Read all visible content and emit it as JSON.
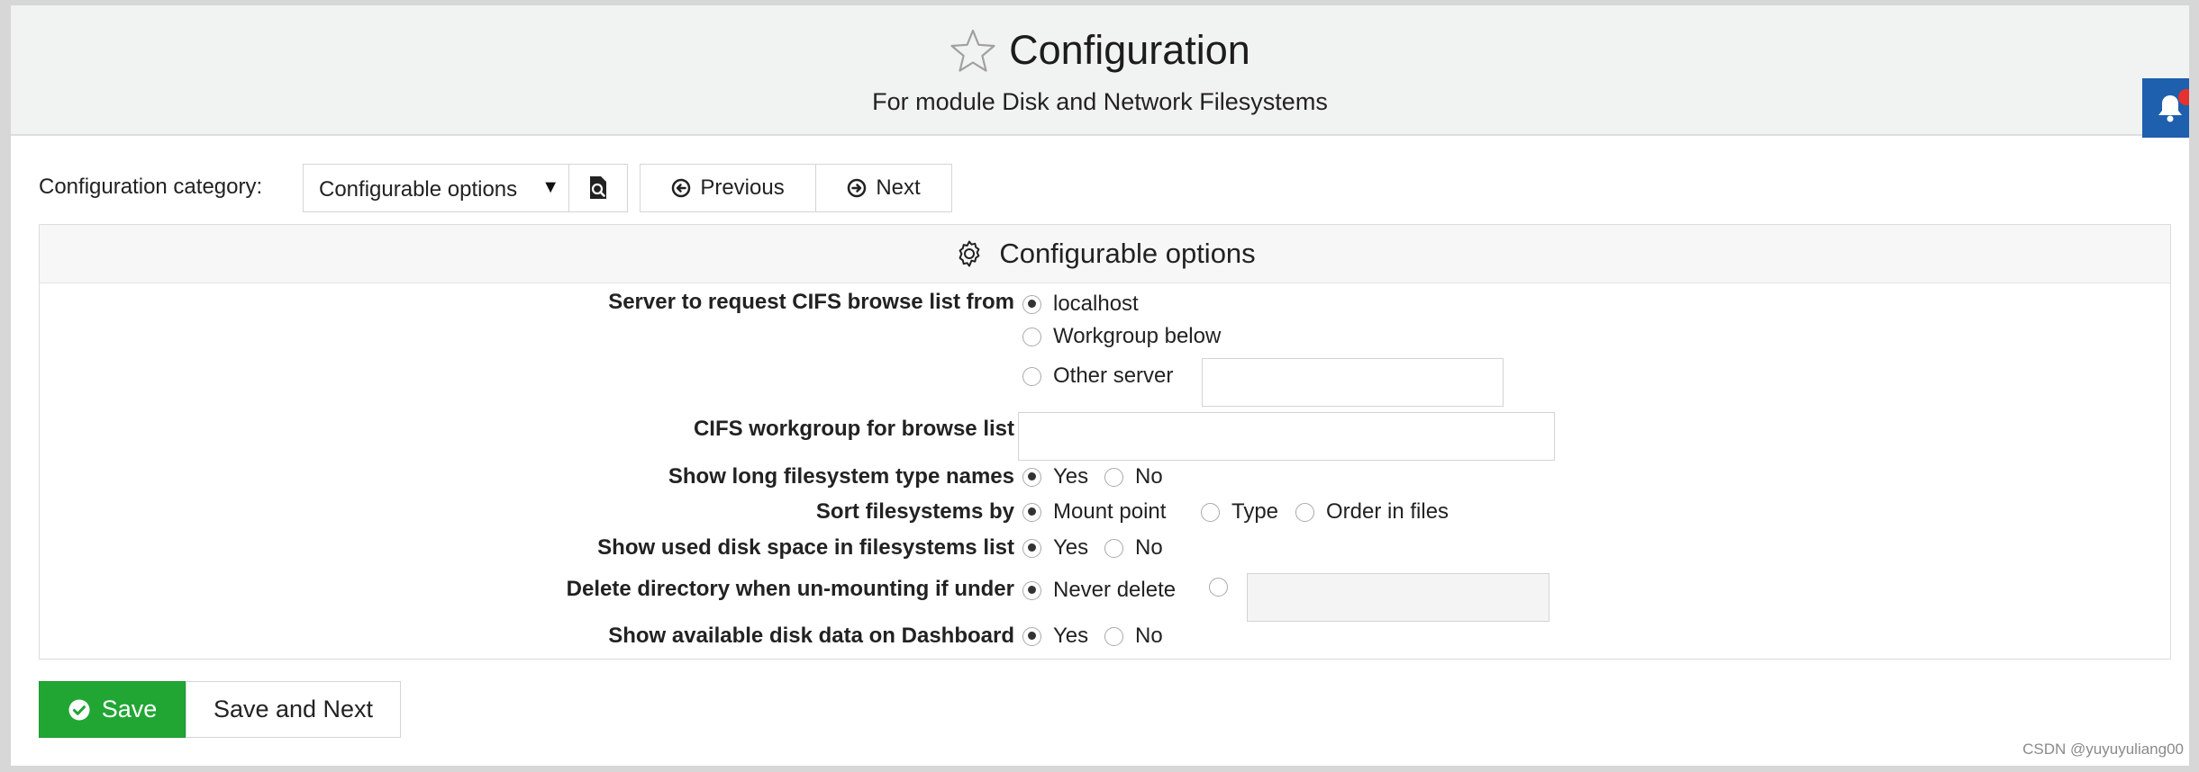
{
  "header": {
    "title": "Configuration",
    "subtitle": "For module Disk and Network Filesystems"
  },
  "toolbar": {
    "category_label": "Configuration category:",
    "category_value": "Configurable options",
    "previous_label": "Previous",
    "next_label": "Next"
  },
  "panel": {
    "title": "Configurable options",
    "rows": [
      {
        "label": "Server to request CIFS browse list from",
        "options": [
          {
            "label": "localhost",
            "selected": true
          },
          {
            "label": "Workgroup below",
            "selected": false
          },
          {
            "label": "Other server",
            "selected": false
          }
        ],
        "input_value": ""
      },
      {
        "label": "CIFS workgroup for browse list",
        "input_value": ""
      },
      {
        "label": "Show long filesystem type names",
        "options": [
          {
            "label": "Yes",
            "selected": true
          },
          {
            "label": "No",
            "selected": false
          }
        ]
      },
      {
        "label": "Sort filesystems by",
        "options": [
          {
            "label": "Mount point",
            "selected": true
          },
          {
            "label": "Type",
            "selected": false
          },
          {
            "label": "Order in files",
            "selected": false
          }
        ]
      },
      {
        "label": "Show used disk space in filesystems list",
        "options": [
          {
            "label": "Yes",
            "selected": true
          },
          {
            "label": "No",
            "selected": false
          }
        ]
      },
      {
        "label": "Delete directory when un-mounting if under",
        "options": [
          {
            "label": "Never delete",
            "selected": true
          },
          {
            "label": "",
            "selected": false
          }
        ],
        "input_value": ""
      },
      {
        "label": "Show available disk data on Dashboard",
        "options": [
          {
            "label": "Yes",
            "selected": true
          },
          {
            "label": "No",
            "selected": false
          }
        ]
      }
    ]
  },
  "actions": {
    "save_label": "Save",
    "save_next_label": "Save and Next"
  },
  "watermark": "CSDN @yuyuyuliang00",
  "icons": {
    "title": "star-outline-icon",
    "category_search": "search-document-icon",
    "previous": "arrow-circle-left-icon",
    "next": "arrow-circle-right-icon",
    "panel": "gear-icon",
    "save": "check-circle-icon",
    "notifications": "bell-icon"
  },
  "colors": {
    "save_button": "#21a634",
    "notification_button": "#1e5fae",
    "notification_dot": "#e5312f",
    "header_background": "#f1f3f2"
  }
}
